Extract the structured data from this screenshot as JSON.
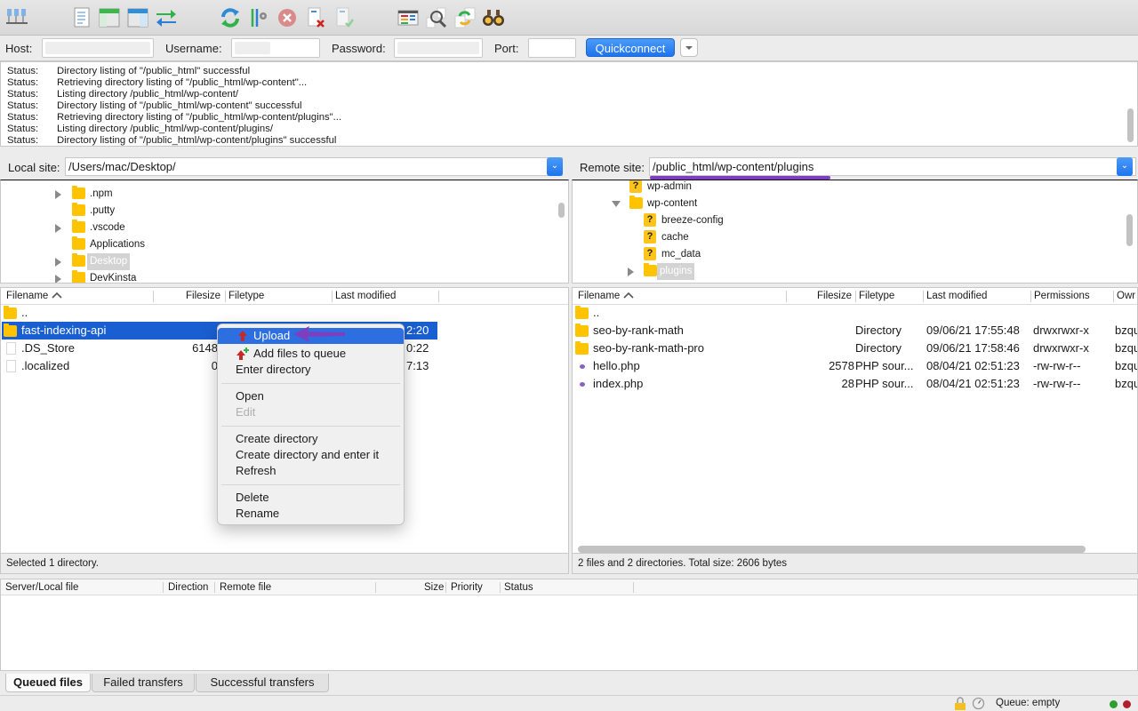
{
  "toolbar": {
    "icons": [
      "site-manager-icon",
      "message-log-toggle-icon",
      "local-tree-toggle-icon",
      "remote-tree-toggle-icon",
      "transfer-queue-toggle-icon",
      "refresh-icon",
      "process-queue-icon",
      "cancel-icon",
      "disconnect-icon",
      "reconnect-icon",
      "directory-listing-filters-icon",
      "directory-comparison-icon",
      "synchronized-browsing-icon",
      "search-remote-files-icon"
    ]
  },
  "quickconnect": {
    "host_label": "Host:",
    "host_value": "",
    "username_label": "Username:",
    "username_value": "",
    "password_label": "Password:",
    "password_value": "",
    "port_label": "Port:",
    "port_value": "",
    "button_label": "Quickconnect"
  },
  "log": [
    {
      "key": "Status:",
      "msg": "Directory listing of \"/public_html\" successful"
    },
    {
      "key": "Status:",
      "msg": "Retrieving directory listing of \"/public_html/wp-content\"..."
    },
    {
      "key": "Status:",
      "msg": "Listing directory /public_html/wp-content/"
    },
    {
      "key": "Status:",
      "msg": "Directory listing of \"/public_html/wp-content\" successful"
    },
    {
      "key": "Status:",
      "msg": "Retrieving directory listing of \"/public_html/wp-content/plugins\"..."
    },
    {
      "key": "Status:",
      "msg": "Listing directory /public_html/wp-content/plugins/"
    },
    {
      "key": "Status:",
      "msg": "Directory listing of \"/public_html/wp-content/plugins\" successful"
    }
  ],
  "local": {
    "site_label": "Local site:",
    "path": "/Users/mac/Desktop/",
    "tree": [
      {
        "name": ".npm",
        "expandable": true
      },
      {
        "name": ".putty",
        "expandable": false
      },
      {
        "name": ".vscode",
        "expandable": true
      },
      {
        "name": "Applications",
        "expandable": false
      },
      {
        "name": "Desktop",
        "expandable": true,
        "selected": true
      },
      {
        "name": "DevKinsta",
        "expandable": true
      }
    ],
    "columns": [
      "Filename",
      "Filesize",
      "Filetype",
      "Last modified"
    ],
    "files": [
      {
        "name": "..",
        "size": "",
        "type": "",
        "modified": ""
      },
      {
        "name": "fast-indexing-api",
        "size": "",
        "type": "",
        "modified": "2:20",
        "selected": true
      },
      {
        "name": ".DS_Store",
        "size": "6148",
        "type": "",
        "modified": "0:22"
      },
      {
        "name": ".localized",
        "size": "0",
        "type": "",
        "modified": "7:13"
      }
    ],
    "status": "Selected 1 directory."
  },
  "remote": {
    "site_label": "Remote site:",
    "path": "/public_html/wp-content/plugins",
    "tree": [
      {
        "name": "wp-admin",
        "unknown": true,
        "level": 1
      },
      {
        "name": "wp-content",
        "expanded": true,
        "level": 1
      },
      {
        "name": "breeze-config",
        "unknown": true,
        "level": 2
      },
      {
        "name": "cache",
        "unknown": true,
        "level": 2
      },
      {
        "name": "mc_data",
        "unknown": true,
        "level": 2
      },
      {
        "name": "plugins",
        "expandable": true,
        "selected": true,
        "level": 2
      }
    ],
    "columns": [
      "Filename",
      "Filesize",
      "Filetype",
      "Last modified",
      "Permissions",
      "Owr"
    ],
    "files": [
      {
        "name": "..",
        "size": "",
        "type": "",
        "modified": "",
        "perms": "",
        "owner": "",
        "kind": "folder"
      },
      {
        "name": "seo-by-rank-math",
        "size": "",
        "type": "Directory",
        "modified": "09/06/21 17:55:48",
        "perms": "drwxrwxr-x",
        "owner": "bzqu",
        "kind": "folder"
      },
      {
        "name": "seo-by-rank-math-pro",
        "size": "",
        "type": "Directory",
        "modified": "09/06/21 17:58:46",
        "perms": "drwxrwxr-x",
        "owner": "bzqu",
        "kind": "folder"
      },
      {
        "name": "hello.php",
        "size": "2578",
        "type": "PHP sour...",
        "modified": "08/04/21 02:51:23",
        "perms": "-rw-rw-r--",
        "owner": "bzqu",
        "kind": "php"
      },
      {
        "name": "index.php",
        "size": "28",
        "type": "PHP sour...",
        "modified": "08/04/21 02:51:23",
        "perms": "-rw-rw-r--",
        "owner": "bzqu",
        "kind": "php"
      }
    ],
    "status": "2 files and 2 directories. Total size: 2606 bytes"
  },
  "context_menu": {
    "items": [
      {
        "label": "Upload",
        "icon": "upload-icon",
        "highlighted": true
      },
      {
        "label": "Add files to queue",
        "icon": "add-to-queue-icon"
      },
      {
        "label": "Enter directory"
      },
      {
        "sep": true
      },
      {
        "label": "Open"
      },
      {
        "label": "Edit",
        "disabled": true
      },
      {
        "sep": true
      },
      {
        "label": "Create directory"
      },
      {
        "label": "Create directory and enter it"
      },
      {
        "label": "Refresh"
      },
      {
        "sep": true
      },
      {
        "label": "Delete"
      },
      {
        "label": "Rename"
      }
    ]
  },
  "queue": {
    "columns": [
      "Server/Local file",
      "Direction",
      "Remote file",
      "Size",
      "Priority",
      "Status"
    ],
    "tabs": [
      "Queued files",
      "Failed transfers",
      "Successful transfers"
    ],
    "active_tab": 0
  },
  "statusbar": {
    "queue_text": "Queue: empty"
  },
  "colors": {
    "accent": "#1f74ee",
    "selection": "#1a5fd1",
    "annotation": "#7b3fbf",
    "folder": "#ffc300"
  }
}
